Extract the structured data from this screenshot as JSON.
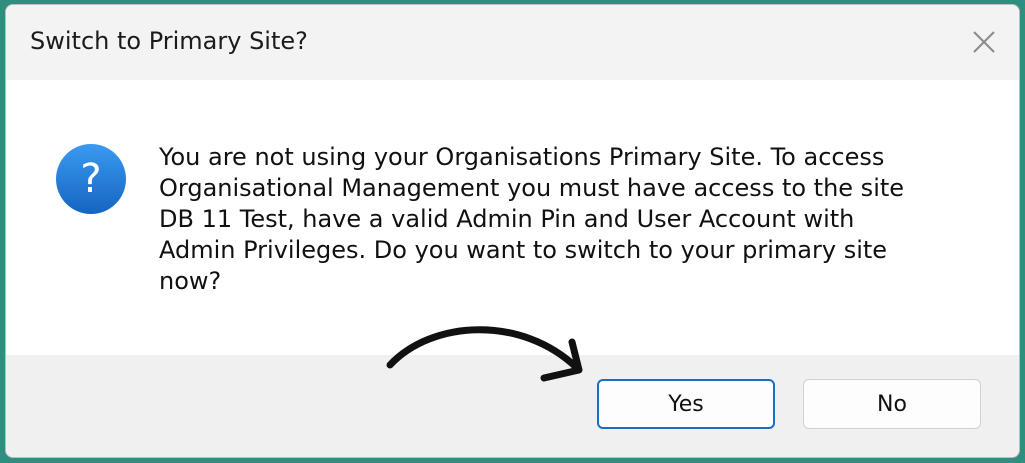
{
  "dialog": {
    "title": "Switch to Primary Site?",
    "message": "You are not using your Organisations Primary Site.  To access\nOrganisational Management you must have access to the site\nDB 11 Test, have a valid Admin Pin and User Account with\nAdmin Privileges.  Do you want to switch to your primary site\nnow?",
    "icon": "question-icon",
    "buttons": {
      "yes": "Yes",
      "no": "No"
    },
    "accent_color": "#1a6fc4",
    "icon_color": "#1f7fd9"
  },
  "annotation": {
    "icon": "hand-drawn-arrow-icon"
  }
}
